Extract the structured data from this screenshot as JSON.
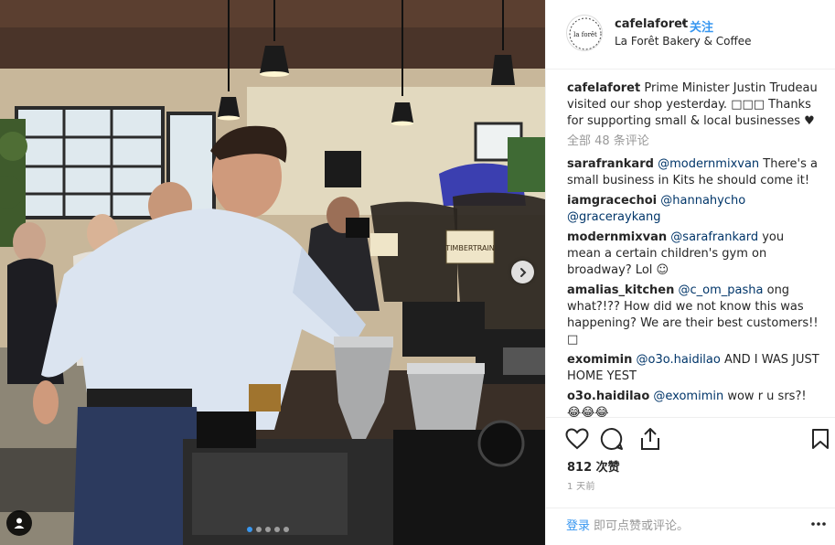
{
  "post": {
    "username": "cafelaforet",
    "separator": "•",
    "follow_label": "关注",
    "location": "La Forêt Bakery & Coffee",
    "avatar_text": "la forêt",
    "caption_user": "cafelaforet",
    "caption_text": "Prime Minister Justin Trudeau visited our shop yesterday. □□□ Thanks for supporting small & local businesses ♥",
    "view_all_comments": "全部 48 条评论",
    "likes": "812 次赞",
    "time_ago": "1 天前"
  },
  "comments": [
    {
      "user": "sarafrankard",
      "mention": "@modernmixvan",
      "text": " There's a small business in Kits he should come it!"
    },
    {
      "user": "iamgracechoi",
      "mention": "@hannahycho",
      "mention2": "@graceraykang",
      "text": ""
    },
    {
      "user": "modernmixvan",
      "mention": "@sarafrankard",
      "text": " you mean a certain children's gym on broadway? Lol ☺"
    },
    {
      "user": "amalias_kitchen",
      "mention": "@c_om_pasha",
      "text": " ong what?!?? How did we not know this was happening? We are their best customers!! □"
    },
    {
      "user": "exomimin",
      "mention": "@o3o.haidilao",
      "text": " AND I WAS JUST HOME YEST"
    },
    {
      "user": "o3o.haidilao",
      "mention": "@exomimin",
      "text": " wow r u srs?! 😂😂😂"
    }
  ],
  "footer": {
    "login_label": "登录",
    "login_prompt": "即可点赞或评论。"
  },
  "photo": {
    "grinder_label_left": "",
    "grinder_label_right": "TIMBERTRAIN"
  },
  "icons": {
    "like": "heart-icon",
    "comment": "comment-bubble-icon",
    "share": "share-icon",
    "save": "bookmark-icon",
    "more": "more-options-icon",
    "next": "chevron-right-icon",
    "tag": "user-tag-icon"
  },
  "colors": {
    "accent": "#3897f0",
    "mention": "#003569",
    "muted": "#999999",
    "border": "#efefef"
  }
}
